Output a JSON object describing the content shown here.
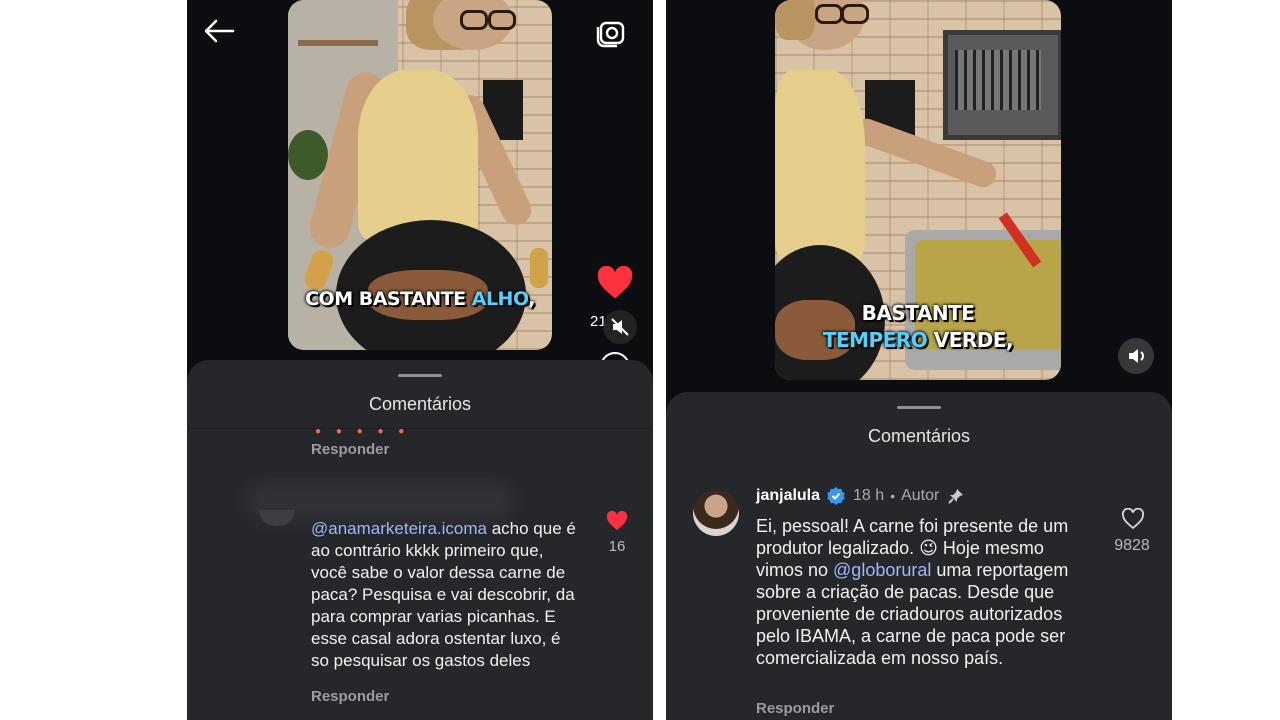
{
  "left": {
    "caption": {
      "prefix": "COM BASTANTE ",
      "highlight": "ALHO",
      "suffix": ","
    },
    "like_count_partial": "21",
    "sheet_title": "Comentários",
    "reply_label_top": "Responder",
    "comment": {
      "text_mention": "@anamarketeira.icoma",
      "text_body": " acho que é ao contrário kkkk primeiro que, você sabe o valor dessa carne de paca? Pesquisa e vai descobrir, da para comprar varias picanhas. E esse casal adora ostentar luxo, é so pesquisar os gastos deles",
      "likes": "16",
      "reply_label": "Responder"
    }
  },
  "right": {
    "caption": {
      "line1": "BASTANTE",
      "highlight": "TEMPERO",
      "suffix": " VERDE,"
    },
    "sheet_title": "Comentários",
    "comment": {
      "username": "janjalula",
      "time": "18 h",
      "separator": "•",
      "author_tag": "Autor",
      "text_part1": "Ei, pessoal! A carne foi presente de um produtor legalizado. 😉 Hoje mesmo vimos no ",
      "mention": "@globorural",
      "text_part2": " uma reportagem sobre a criação de pacas. Desde que proveniente de criadouros autorizados pelo IBAMA, a carne de paca pode ser comercializada em nosso país.",
      "likes": "9828",
      "reply_label": "Responder"
    }
  },
  "colors": {
    "background": "#0b0d10",
    "sheet": "#25272b",
    "heart_red": "#ff3040",
    "caption_highlight": "#4fd2ff",
    "verified_blue": "#3797f0",
    "mention": "#9fb7ff"
  },
  "icons": [
    "back-arrow-icon",
    "camera-icon",
    "heart-filled-icon",
    "muted-speaker-icon",
    "volume-icon",
    "verified-badge-icon",
    "pin-icon",
    "heart-outline-icon"
  ]
}
